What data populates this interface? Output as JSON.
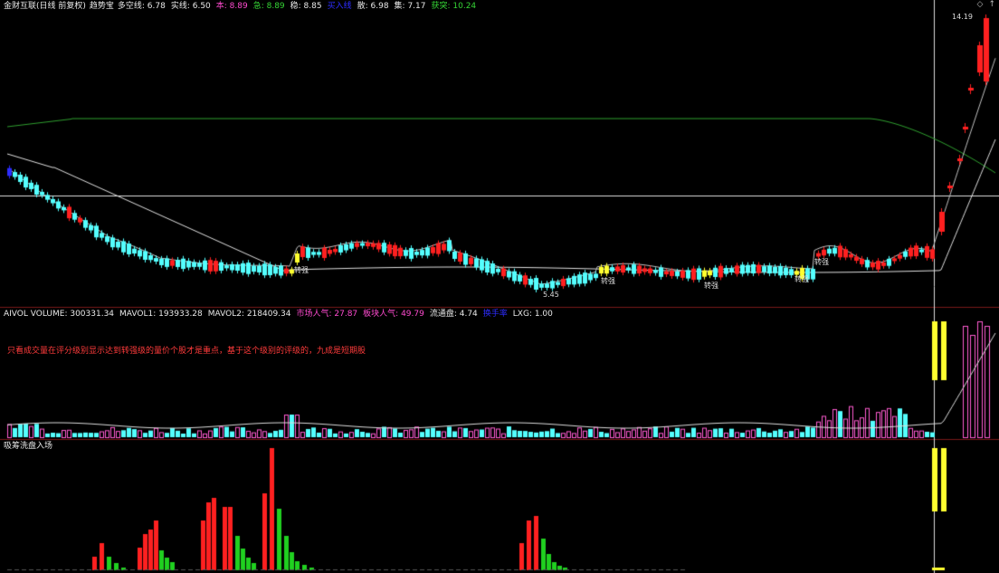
{
  "header": {
    "stock": "金财互联(日线 前复权)",
    "indicator": "趋势宝",
    "items": [
      {
        "label": "多空线: 6.78",
        "color": "#e8e8e8"
      },
      {
        "label": "实线: 6.50",
        "color": "#e8e8e8"
      },
      {
        "label": "本: 8.89",
        "color": "#ff4bd0"
      },
      {
        "label": "急: 8.89",
        "color": "#35d435"
      },
      {
        "label": "稳: 8.85",
        "color": "#e8e8e8"
      },
      {
        "label": "买入线",
        "color": "#2d2dff"
      },
      {
        "label": "散: 6.98",
        "color": "#e8e8e8"
      },
      {
        "label": "集: 7.17",
        "color": "#e8e8e8"
      },
      {
        "label": "获突: 10.24",
        "color": "#35d435"
      }
    ],
    "icons": [
      "diamond-icon",
      "arrow-icon"
    ]
  },
  "price_labels": {
    "high": "14.19",
    "low": "5.45",
    "turn": "转强"
  },
  "volume_header": {
    "items": [
      {
        "label": "AIVOL VOLUME: 300331.34",
        "color": "#e8e8e8"
      },
      {
        "label": "MAVOL1: 193933.28",
        "color": "#e8e8e8"
      },
      {
        "label": "MAVOL2: 218409.34",
        "color": "#e8e8e8"
      },
      {
        "label": "市场人气: 27.87",
        "color": "#ff4bd0"
      },
      {
        "label": "板块人气: 49.79",
        "color": "#ff4bd0"
      },
      {
        "label": "流通盘: 4.74",
        "color": "#e8e8e8"
      },
      {
        "label": "换手率",
        "color": "#2d2dff"
      },
      {
        "label": "LXG: 1.00",
        "color": "#e8e8e8"
      }
    ],
    "note": "只看成交量在评分级别显示达到转强级的量价个股才是重点，基于这个级别的评级的，九成是短期股"
  },
  "capital_header": {
    "title": "吸筹洗盘入场"
  },
  "colors": {
    "up": "#ff2020",
    "down": "#54ffff",
    "green": "#20d020",
    "yellow": "#ffff30",
    "ma_long": "#2f9f2f"
  }
}
